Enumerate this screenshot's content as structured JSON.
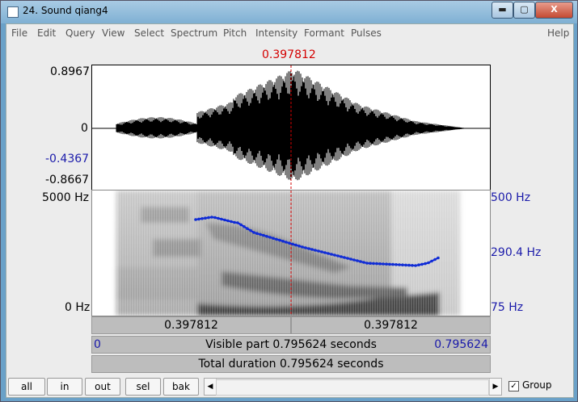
{
  "window": {
    "title": "24. Sound qiang4",
    "minimize": "▬",
    "maximize": "▢",
    "close": "X"
  },
  "menu": [
    "File",
    "Edit",
    "Query",
    "View",
    "Select",
    "Spectrum",
    "Pitch",
    "Intensity",
    "Formant",
    "Pulses",
    "Help"
  ],
  "cursor": {
    "time": "0.397812"
  },
  "waveform": {
    "max": "0.8967",
    "zero": "0",
    "cursor_value": "-0.4367",
    "min": "-0.8667"
  },
  "spectrogram": {
    "freq_top": "5000 Hz",
    "freq_bottom": "0 Hz"
  },
  "pitch_axis": {
    "top": "500 Hz",
    "mid": "290.4 Hz",
    "bottom": "75 Hz"
  },
  "time_bar": {
    "left": "0.397812",
    "right": "0.397812"
  },
  "visible_bar": {
    "start": "0",
    "label": "Visible part 0.795624 seconds",
    "end": "0.795624"
  },
  "total_bar": {
    "label": "Total duration 0.795624 seconds"
  },
  "buttons": [
    "all",
    "in",
    "out",
    "sel",
    "bak"
  ],
  "group": {
    "label": "Group",
    "checked": true
  },
  "colors": {
    "cursor": "#d40000",
    "pitch": "#0000ff",
    "axis_blue": "#1a1aaa"
  }
}
